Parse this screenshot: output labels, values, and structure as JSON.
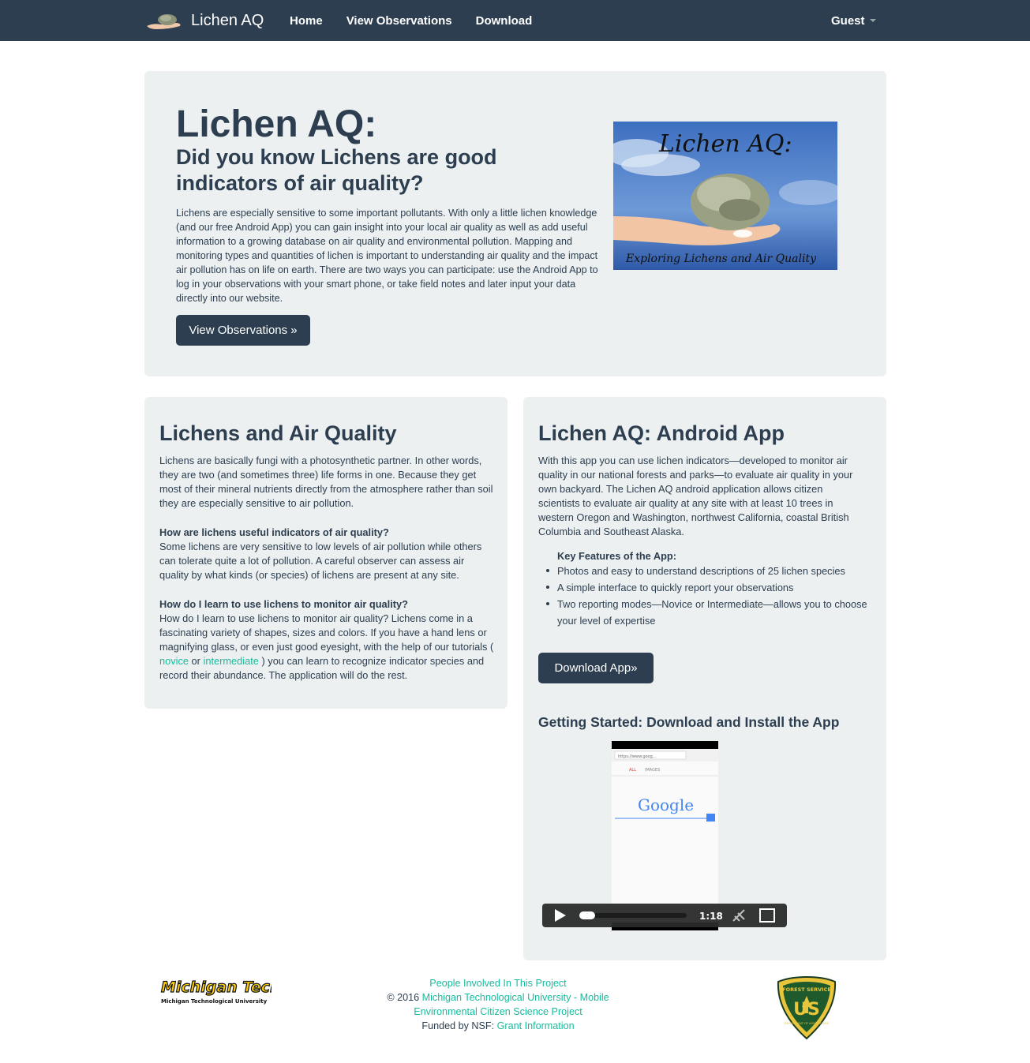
{
  "nav": {
    "brand": "Lichen AQ",
    "links": [
      "Home",
      "View Observations",
      "Download"
    ],
    "user": "Guest"
  },
  "jumbo": {
    "title": "Lichen AQ:",
    "subtitle": "Did you know Lichens are good indicators of air quality?",
    "text": "Lichens are especially sensitive to some important pollutants. With only a little lichen knowledge (and our free Android App) you can gain insight into your local air quality as well as add useful information to a growing database on air quality and environmental pollution. Mapping and monitoring types and quantities of lichen is important to understanding air quality and the impact air pollution has on life on earth. There are two ways you can participate: use the Android App to log in your observations with your smart phone, or take field notes and later input your data directly into our website.",
    "button": "View Observations »",
    "image_title": "Lichen AQ:",
    "image_caption": "Exploring Lichens and Air Quality"
  },
  "left_panel": {
    "title": "Lichens and Air Quality",
    "intro": "Lichens are basically fungi with a photosynthetic partner. In other words, they are two (and sometimes three) life forms in one. Because they get most of their mineral nutrients directly from the atmosphere rather than soil they are especially sensitive to air pollution.",
    "q1": "How are lichens useful indicators of air quality?",
    "a1": "Some lichens are very sensitive to low levels of air pollution while others can tolerate quite a lot of pollution. A careful observer can assess air quality by what kinds (or species) of lichens are present at any site.",
    "q2": "How do I learn to use lichens to monitor air quality?",
    "a2_pre": "How do I learn to use lichens to monitor air quality? Lichens come in a fascinating variety of shapes, sizes and colors. If you have a hand lens or magnifying glass, or even just good eyesight, with the help of our tutorials ( ",
    "a2_link1": "novice",
    "a2_mid": " or ",
    "a2_link2": "intermediate",
    "a2_post": " ) you can learn to recognize indicator species and record their abundance. The application will do the rest."
  },
  "right_panel": {
    "title": "Lichen AQ: Android App",
    "intro": "With this app you can use lichen indicators—developed to monitor air quality in our national forests and parks—to evaluate air quality in your own backyard. The Lichen AQ android application allows citizen scientists to evaluate air quality at any site with at least 10 trees in western Oregon and Washington, northwest California, coastal British Columbia and Southeast Alaska.",
    "features_title": "Key Features of the App:",
    "features": [
      "Photos and easy to understand descriptions of 25 lichen species",
      "A simple interface to quickly report your observations",
      "Two reporting modes—Novice or Intermediate—allows you to choose your level of expertise"
    ],
    "download_button": "Download App»",
    "getting_started": "Getting Started: Download and Install the App",
    "video": {
      "url_text": "https://www.goog...",
      "tab1": "ALL",
      "tab2": "IMAGES",
      "search_logo": "Google",
      "duration": "1:18"
    }
  },
  "footer": {
    "people_link": "People Involved In This Project",
    "copyright": "© 2016",
    "mtu_link": "Michigan Technological University",
    "sep": "-",
    "project_link": "Mobile Environmental Citizen Science Project",
    "funded": "Funded by NSF:",
    "grant_link": "Grant Information",
    "mtu_logo_text": "Michigan Tech",
    "mtu_logo_sub": "Michigan Technological University",
    "usfs_top": "FOREST SERVICE",
    "usfs_mid": "US",
    "usfs_bottom": "DEPARTMENT OF AGRICULTURE"
  },
  "colors": {
    "primary": "#2c3e50",
    "panel_bg": "#ecf0f1",
    "link": "#18bc9c"
  }
}
